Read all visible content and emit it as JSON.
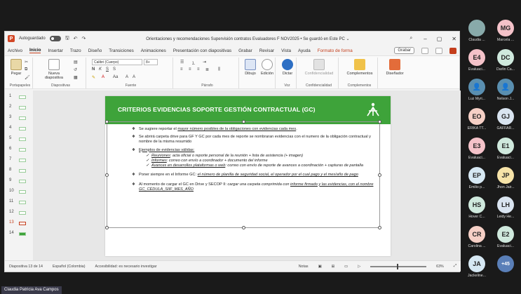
{
  "window": {
    "autosave_label": "Autoguardado",
    "doc_title": "Orientaciones y recomendaciones Supervisión contratos Evaluadores F NOV2025 • Se guardó en Este PC ⌄"
  },
  "menu": {
    "items": [
      "Archivo",
      "Inicio",
      "Insertar",
      "Trazo",
      "Diseño",
      "Transiciones",
      "Animaciones",
      "Presentación con diapositivas",
      "Grabar",
      "Revisar",
      "Vista",
      "Ayuda",
      "Formato de forma"
    ],
    "active": "Inicio",
    "record_label": "Grabar"
  },
  "ribbon": {
    "paste": "Pegar",
    "new_slide": "Nueva diapositiva",
    "font_name": "Calibri (Cuerpo)",
    "font_size": "8+",
    "draw": "Dibujo",
    "edit": "Edición",
    "dictate": "Dictar",
    "confidentiality": "Confidencialidad",
    "addins": "Complementos",
    "designer": "Diseñador",
    "groups": {
      "clipboard": "Portapapeles",
      "slides": "Diapositivas",
      "font": "Fuente",
      "paragraph": "Párrafo",
      "voice": "Voz",
      "confidentiality": "Confidencialidad",
      "addins": "Complementos"
    }
  },
  "thumbnails": [
    1,
    2,
    3,
    4,
    5,
    6,
    7,
    8,
    9,
    10,
    11,
    12,
    13,
    14
  ],
  "selected_slide": 13,
  "slide": {
    "title": "CRITERIOS EVIDENCIAS SOPORTE GESTIÓN CONTRACTUAL (GC)",
    "b1_pre": "Se sugiere reportar el ",
    "b1_u": "mayor número posibles de la obligaciones con evidencias cada mes",
    "b1_post": ".",
    "b2": "Se abrirá carpeta drive para GF Y GC  por cada mes de reporte se nombraran  evidencias con el numero de la obligación contractual y nombre de la misma resumido",
    "b3": "Ejemplos de evidencias válidas:",
    "s1_u": "Reuniones",
    "s1": ": acta oficial o reporte personal de la reunión + lista de asistencia (+ imagen)",
    "s2_u": "Informes",
    "s2": ": correo con envío a coordinador + documento del informe",
    "s3_u": "Avances en desarrollos plataformas o web",
    "s3": ": correo con envío de reporte de avances a coordinación + capturas de pantalla",
    "b4_pre": "Poner siempre en el Informe GC: ",
    "b4_u": "el número de planilla de seguridad social, el operador por el cual pago y el mes/año de pago",
    "b5_pre": "Al momento de cargar el GC en Drive y SECOP II: ",
    "b5_i": "cargar una carpeta comprimida con ",
    "b5_u": "informe firmado y las evidencias, con el nombre GC_CÉDULA_SIIF_MES_AÑO"
  },
  "status": {
    "slide_of": "Diapositiva 13 de 14",
    "lang": "Español (Colombia)",
    "accessibility": "Accesibilidad: es necesario investigar",
    "notes": "Notas",
    "zoom": "63%"
  },
  "participants": [
    {
      "initials": "",
      "name": "Claudia ...",
      "color": "#8aa",
      "photo": true
    },
    {
      "initials": "MG",
      "name": "Marcela ...",
      "color": "#f4c2c9"
    },
    {
      "initials": "E4",
      "name": "Evaluaci...",
      "color": "#f4c2c9"
    },
    {
      "initials": "DC",
      "name": "Darlin Ca...",
      "color": "#cfe9dd"
    },
    {
      "initials": "",
      "name": "Luz Myri...",
      "color": "#5a8fb0",
      "icon": true
    },
    {
      "initials": "",
      "name": "Nelson J...",
      "color": "#5a8fb0",
      "icon": true
    },
    {
      "initials": "EO",
      "name": "ERIKA TT...",
      "color": "#f6d0c6"
    },
    {
      "initials": "GJ",
      "name": "GAFFAR...",
      "color": "#d9e4f0"
    },
    {
      "initials": "E3",
      "name": "Evaluaci...",
      "color": "#f4c2c9"
    },
    {
      "initials": "E1",
      "name": "Evaluaci...",
      "color": "#cfe9dd"
    },
    {
      "initials": "EP",
      "name": "Emilio p...",
      "color": "#d6e8f3"
    },
    {
      "initials": "JP",
      "name": "Jhon Jair...",
      "color": "#f6e3a8"
    },
    {
      "initials": "HS",
      "name": "Hover C...",
      "color": "#cfe9dd"
    },
    {
      "initials": "LH",
      "name": "Leidy He...",
      "color": "#d9e4f0"
    },
    {
      "initials": "CR",
      "name": "Carolina ...",
      "color": "#f6d0c6"
    },
    {
      "initials": "E2",
      "name": "Evaluaci...",
      "color": "#cfe9dd"
    },
    {
      "initials": "JA",
      "name": "Jackeline...",
      "color": "#d6e8f3"
    },
    {
      "initials": "+45",
      "name": "",
      "color": "#5a7fb8",
      "more": true
    }
  ],
  "presenter": "Claudia Patricia Ava Campos"
}
